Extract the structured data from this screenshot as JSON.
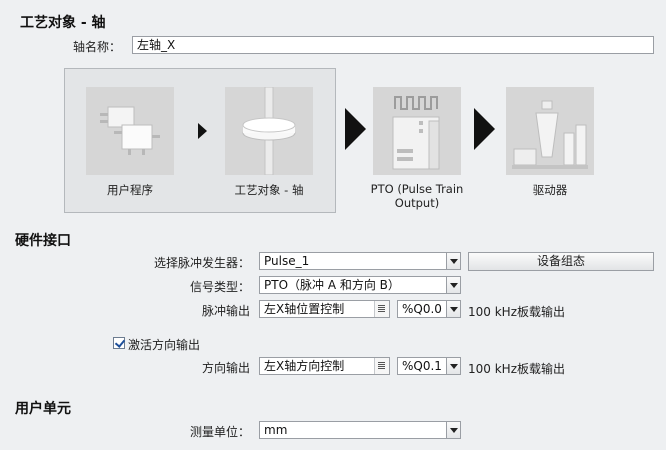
{
  "tech_object_title": "工艺对象 - 轴",
  "axis_name": {
    "label": "轴名称：",
    "value": "左轴_X"
  },
  "diagram": {
    "tile1_label": "用户程序",
    "tile2_label": "工艺对象 - 轴",
    "tile3_label_line1": "PTO (Pulse Train",
    "tile3_label_line2": "Output)",
    "tile4_label": "驱动器"
  },
  "hardware_interface": {
    "title": "硬件接口",
    "pulse_generator": {
      "label": "选择脉冲发生器：",
      "value": "Pulse_1"
    },
    "device_config_button": "设备组态",
    "signal_type": {
      "label": "信号类型：",
      "value": "PTO（脉冲 A 和方向 B）"
    },
    "pulse_output": {
      "label": "脉冲输出",
      "tag": "左X轴位置控制",
      "address": "%Q0.0",
      "info": "100 kHz板载输出"
    },
    "enable_direction": {
      "label": "激活方向输出",
      "checked": true
    },
    "direction_output": {
      "label": "方向输出",
      "tag": "左X轴方向控制",
      "address": "%Q0.1",
      "info": "100 kHz板载输出"
    }
  },
  "user_unit": {
    "title": "用户单元",
    "measurement_unit": {
      "label": "测量单位：",
      "value": "mm"
    }
  },
  "icons": [
    "dropdown-arrow-icon",
    "browse-list-icon",
    "checkmark-icon",
    "flow-arrow-icon"
  ]
}
